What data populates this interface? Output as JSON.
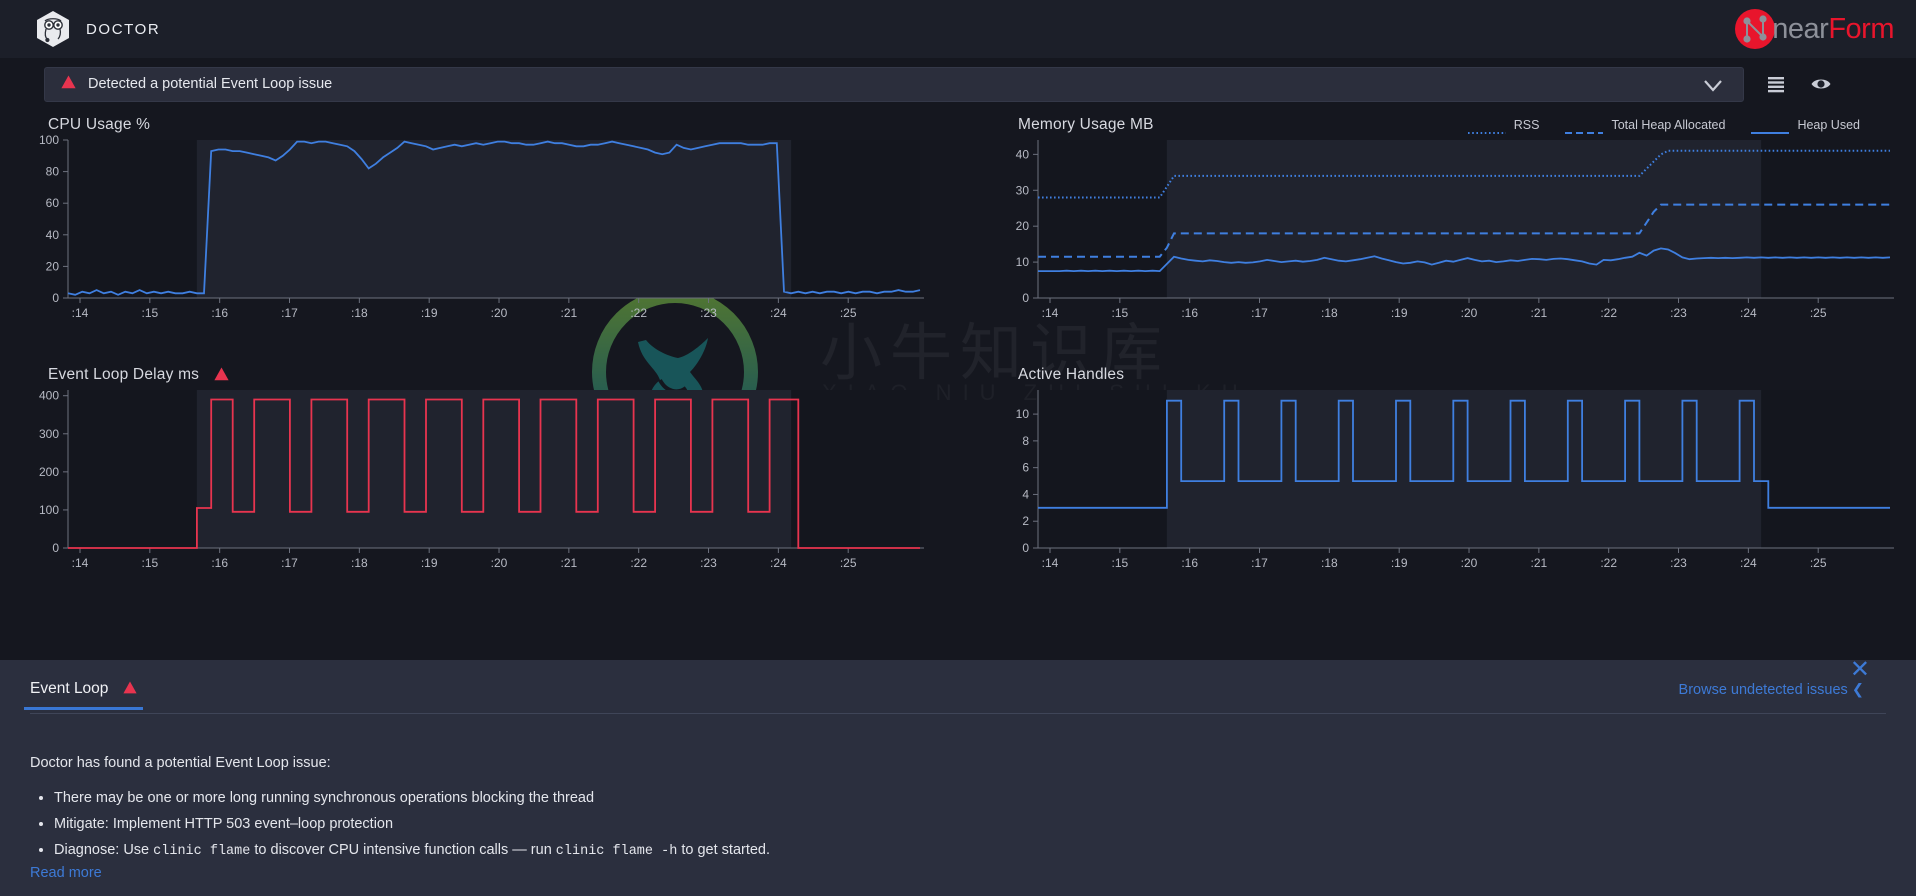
{
  "header": {
    "app_title": "DOCTOR",
    "logo_icon": "doctor-hexagon-icon",
    "brand_near": "near",
    "brand_form": "Form",
    "brand_icon": "nearform-node-logo-icon"
  },
  "alert_bar": {
    "warning_icon": "warning-triangle-icon",
    "message": "Detected a potential Event Loop issue",
    "chevron_icon": "chevron-down-icon",
    "list_icon": "list-view-icon",
    "eye_icon": "eye-visibility-icon",
    "accent_color": "#e8344f",
    "background": "#2b2e3c"
  },
  "colors": {
    "blue_line": "#3f7fe0",
    "red_line": "#e8344f",
    "panel_bg": "#2b2f3e",
    "page_bg": "#15171f",
    "chart_bg": "#14161e",
    "highlight_bg": "#1d202a",
    "link": "#3d7ad6"
  },
  "watermark": {
    "cn_text": "小牛知识库",
    "en_text": "XIAO NIU ZHI SHI KU"
  },
  "panel": {
    "tab_label": "Event Loop",
    "tab_warning_icon": "warning-triangle-icon",
    "browse_label": "Browse undetected issues ❮",
    "close_icon": "close-icon",
    "lead": "Doctor has found a potential Event Loop issue:",
    "bullets": [
      {
        "pre": "There may be one or more long running synchronous operations blocking the thread"
      },
      {
        "pre": "Mitigate: Implement HTTP 503 event–loop protection"
      },
      {
        "pre": "Diagnose: Use ",
        "code1": "clinic flame",
        "mid": " to discover CPU intensive function calls — run ",
        "code2": "clinic flame -h",
        "post": " to get started."
      }
    ],
    "read_more": "Read more"
  },
  "chart_data": [
    {
      "id": "cpu",
      "type": "line",
      "title": "CPU Usage %",
      "xlabel": "",
      "ylabel": "",
      "ylim": [
        0,
        100
      ],
      "yticks": [
        0,
        20,
        40,
        60,
        80,
        100
      ],
      "xticks": [
        ":14",
        ":15",
        ":16",
        ":17",
        ":18",
        ":19",
        ":20",
        ":21",
        ":22",
        ":23",
        ":24",
        ":25"
      ],
      "grid": false,
      "legend": [],
      "highlight_range": [
        ":14.6",
        ":24.3"
      ],
      "series": [
        {
          "name": "CPU Usage",
          "color": "#3f7fe0",
          "style": "solid",
          "values": [
            3,
            2,
            4,
            3,
            5,
            3,
            4,
            2,
            4,
            3,
            5,
            3,
            4,
            3,
            4,
            3,
            3,
            4,
            3,
            3,
            93,
            94,
            94,
            93,
            93,
            92,
            91,
            90,
            89,
            87,
            90,
            94,
            99,
            99,
            98,
            99,
            99,
            98,
            97,
            96,
            93,
            88,
            82,
            85,
            89,
            92,
            95,
            99,
            98,
            97,
            96,
            94,
            95,
            96,
            97,
            96,
            97,
            98,
            97,
            98,
            99,
            99,
            98,
            98,
            97,
            97,
            98,
            99,
            98,
            98,
            97,
            96,
            96,
            97,
            97,
            98,
            99,
            98,
            97,
            96,
            95,
            94,
            92,
            91,
            92,
            97,
            95,
            94,
            95,
            96,
            97,
            98,
            98,
            98,
            98,
            97,
            97,
            97,
            98,
            98,
            4,
            3,
            4,
            3,
            4,
            3,
            4,
            4,
            3,
            4,
            3,
            4,
            4,
            3,
            4,
            4,
            5,
            4,
            4,
            5
          ]
        }
      ]
    },
    {
      "id": "memory",
      "type": "line",
      "title": "Memory Usage MB",
      "xlabel": "",
      "ylabel": "",
      "ylim": [
        0,
        44
      ],
      "yticks": [
        0,
        10,
        20,
        30,
        40
      ],
      "xticks": [
        ":14",
        ":15",
        ":16",
        ":17",
        ":18",
        ":19",
        ":20",
        ":21",
        ":22",
        ":23",
        ":24",
        ":25"
      ],
      "grid": false,
      "highlight_range": [
        ":14.6",
        ":24.3"
      ],
      "legend": [
        {
          "label": "RSS",
          "style": "dotted",
          "color": "#3f7fe0"
        },
        {
          "label": "Total Heap Allocated",
          "style": "dashed",
          "color": "#3f7fe0"
        },
        {
          "label": "Heap Used",
          "style": "solid",
          "color": "#3f7fe0"
        }
      ],
      "series": [
        {
          "name": "RSS",
          "color": "#3f7fe0",
          "style": "dotted",
          "values": [
            28,
            28,
            28,
            28,
            28,
            28,
            28,
            28,
            28,
            28,
            28,
            28,
            28,
            28,
            28,
            28,
            28,
            28,
            31,
            34,
            34,
            34,
            34,
            34,
            34,
            34,
            34,
            34,
            34,
            34,
            34,
            34,
            34,
            34,
            34,
            34,
            34,
            34,
            34,
            34,
            34,
            34,
            34,
            34,
            34,
            34,
            34,
            34,
            34,
            34,
            34,
            34,
            34,
            34,
            34,
            34,
            34,
            34,
            34,
            34,
            34,
            34,
            34,
            34,
            34,
            34,
            34,
            34,
            34,
            34,
            34,
            34,
            34,
            34,
            34,
            34,
            34,
            34,
            34,
            34,
            34,
            34,
            34,
            34,
            34,
            36,
            38,
            40,
            41,
            41,
            41,
            41,
            41,
            41,
            41,
            41,
            41,
            41,
            41,
            41,
            41,
            41,
            41,
            41,
            41,
            41,
            41,
            41,
            41,
            41,
            41,
            41,
            41,
            41,
            41,
            41,
            41,
            41,
            41,
            41
          ]
        },
        {
          "name": "Total Heap Allocated",
          "color": "#3f7fe0",
          "style": "dashed",
          "values": [
            11.5,
            11.5,
            11.5,
            11.5,
            11.5,
            11.5,
            11.5,
            11.5,
            11.5,
            11.5,
            11.5,
            11.5,
            11.5,
            11.5,
            11.5,
            11.5,
            11.5,
            11.5,
            14,
            18,
            18,
            18,
            18,
            18,
            18,
            18,
            18,
            18,
            18,
            18,
            18,
            18,
            18,
            18,
            18,
            18,
            18,
            18,
            18,
            18,
            18,
            18,
            18,
            18,
            18,
            18,
            18,
            18,
            18,
            18,
            18,
            18,
            18,
            18,
            18,
            18,
            18,
            18,
            18,
            18,
            18,
            18,
            18,
            18,
            18,
            18,
            18,
            18,
            18,
            18,
            18,
            18,
            18,
            18,
            18,
            18,
            18,
            18,
            18,
            18,
            18,
            18,
            18,
            18,
            18,
            21,
            24,
            26,
            26,
            26,
            26,
            26,
            26,
            26,
            26,
            26,
            26,
            26,
            26,
            26,
            26,
            26,
            26,
            26,
            26,
            26,
            26,
            26,
            26,
            26,
            26,
            26,
            26,
            26,
            26,
            26,
            26,
            26,
            26,
            26
          ]
        },
        {
          "name": "Heap Used",
          "color": "#3f7fe0",
          "style": "solid",
          "values": [
            7.5,
            7.5,
            7.5,
            7.5,
            7.6,
            7.5,
            7.6,
            7.5,
            7.6,
            7.5,
            7.6,
            7.5,
            7.6,
            7.5,
            7.6,
            7.5,
            7.6,
            7.5,
            9.5,
            11.5,
            11,
            10.6,
            10.4,
            10.2,
            10.5,
            10.3,
            10,
            9.8,
            10,
            9.8,
            9.9,
            10.2,
            10.6,
            10.3,
            10,
            10.2,
            10.4,
            10.1,
            10.3,
            10.6,
            11.2,
            10.8,
            10.4,
            10.2,
            10.5,
            10.8,
            11.2,
            11.6,
            11,
            10.5,
            10,
            9.6,
            9.8,
            10.2,
            9.9,
            9.3,
            9.8,
            10.4,
            10.1,
            10.6,
            11.1,
            10.6,
            10.2,
            10.4,
            10,
            10.2,
            10.5,
            10.3,
            10.6,
            10.9,
            10.8,
            10.6,
            10.9,
            11,
            10.8,
            10.5,
            10.2,
            9.6,
            9.3,
            10.6,
            10.5,
            10.8,
            11.2,
            11.5,
            12.6,
            11.8,
            13.2,
            13.8,
            13.5,
            12.5,
            11.3,
            10.8,
            11,
            11.1,
            11.2,
            11.1,
            11.2,
            11.1,
            11.2,
            11.3,
            11.2,
            11.3,
            11.2,
            11.3,
            11.2,
            11.3,
            11.2,
            11.3,
            11.2,
            11.3,
            11.2,
            11.3,
            11.2,
            11.3,
            11.2,
            11.3,
            11.2,
            11.3,
            11.2,
            11.3
          ]
        }
      ]
    },
    {
      "id": "event_loop_delay",
      "type": "line",
      "title": "Event Loop Delay ms",
      "warning_icon": "warning-triangle-icon",
      "xlabel": "",
      "ylabel": "",
      "ylim": [
        0,
        415
      ],
      "yticks": [
        0,
        100,
        200,
        300,
        400
      ],
      "xticks": [
        ":14",
        ":15",
        ":16",
        ":17",
        ":18",
        ":19",
        ":20",
        ":21",
        ":22",
        ":23",
        ":24",
        ":25"
      ],
      "grid": false,
      "highlight_range": [
        ":14.6",
        ":24.3"
      ],
      "square_wave": {
        "baseline": 0,
        "low": 95,
        "high": 390,
        "start_index": 18,
        "ramp_value": 105,
        "period": 8,
        "high_width": 5,
        "end_index": 101
      },
      "series": [
        {
          "name": "Event Loop Delay",
          "color": "#e8344f",
          "style": "solid",
          "values": []
        }
      ]
    },
    {
      "id": "active_handles",
      "type": "line",
      "title": "Active Handles",
      "xlabel": "",
      "ylabel": "",
      "ylim": [
        0,
        11.8
      ],
      "yticks": [
        0,
        2,
        4,
        6,
        8,
        10
      ],
      "xticks": [
        ":14",
        ":15",
        ":16",
        ":17",
        ":18",
        ":19",
        ":20",
        ":21",
        ":22",
        ":23",
        ":24",
        ":25"
      ],
      "grid": false,
      "highlight_range": [
        ":14.6",
        ":24.3"
      ],
      "square_wave": {
        "baseline": 3,
        "low": 5,
        "high": 11,
        "start_index": 18,
        "period": 8,
        "high_width": 1.6,
        "end_index": 101,
        "tail": 3
      },
      "series": [
        {
          "name": "Active Handles",
          "color": "#3f7fe0",
          "style": "solid",
          "values": []
        }
      ]
    }
  ]
}
